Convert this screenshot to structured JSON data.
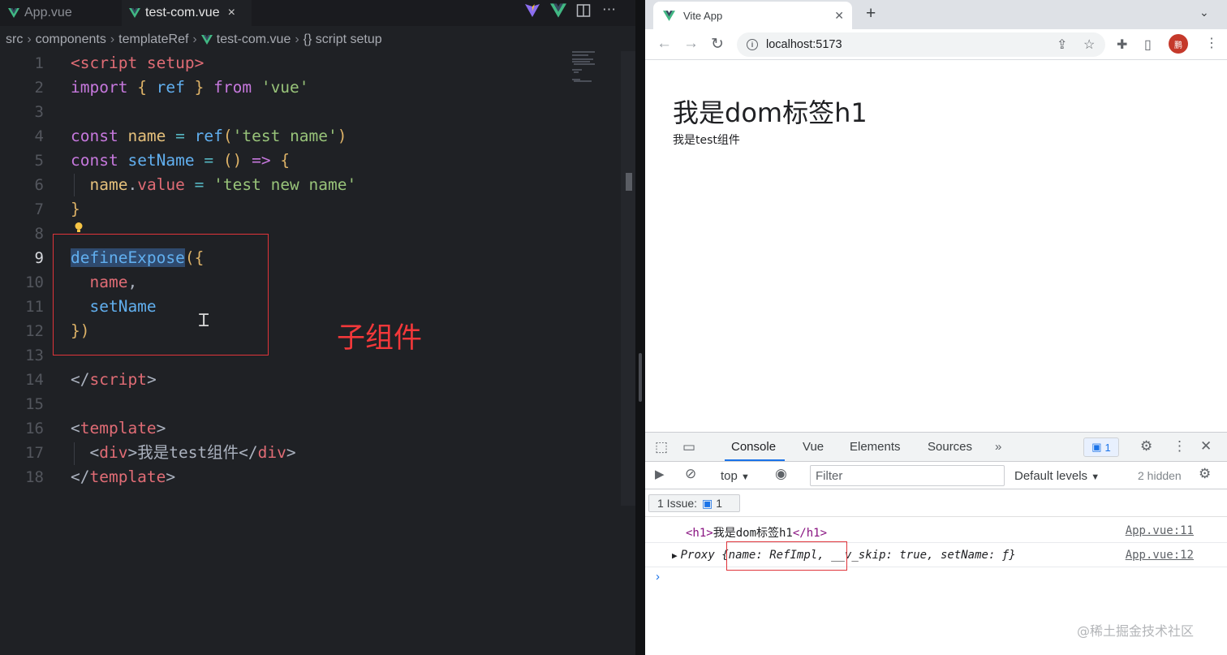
{
  "editor": {
    "tabs": [
      {
        "label": "App.vue",
        "active": false
      },
      {
        "label": "test-com.vue",
        "active": true
      }
    ],
    "tab_close": "×",
    "breadcrumb": [
      "src",
      "components",
      "templateRef",
      "test-com.vue",
      "{} script setup"
    ],
    "line_numbers": [
      "1",
      "2",
      "3",
      "4",
      "5",
      "6",
      "7",
      "8",
      "9",
      "10",
      "11",
      "12",
      "13",
      "14",
      "15",
      "16",
      "17",
      "18"
    ],
    "current_line": "9",
    "lines": [
      [
        [
          "t",
          "<script setup>"
        ]
      ],
      [
        [
          "k",
          "import "
        ],
        [
          "y",
          "{ "
        ],
        [
          "f",
          "ref "
        ],
        [
          "y",
          "} "
        ],
        [
          "k",
          "from "
        ],
        [
          "s",
          "'vue'"
        ]
      ],
      [],
      [
        [
          "k",
          "const "
        ],
        [
          "p",
          "name "
        ],
        [
          "c",
          "= "
        ],
        [
          "f",
          "ref"
        ],
        [
          "y",
          "("
        ],
        [
          "s",
          "'test name'"
        ],
        [
          "y",
          ")"
        ]
      ],
      [
        [
          "k",
          "const "
        ],
        [
          "f",
          "setName "
        ],
        [
          "c",
          "= "
        ],
        [
          "y",
          "() "
        ],
        [
          "k",
          "=> "
        ],
        [
          "y",
          "{"
        ]
      ],
      [
        [
          "g",
          "  "
        ],
        [
          "p",
          "name"
        ],
        [
          "g",
          "."
        ],
        [
          "t",
          "value "
        ],
        [
          "c",
          "= "
        ],
        [
          "s",
          "'test new name'"
        ]
      ],
      [
        [
          "y",
          "}"
        ]
      ],
      [],
      [
        [
          "fsel",
          "defineExpose"
        ],
        [
          "y",
          "({"
        ]
      ],
      [
        [
          "g",
          "  "
        ],
        [
          "t",
          "name"
        ],
        [
          "g",
          ","
        ]
      ],
      [
        [
          "g",
          "  "
        ],
        [
          "f",
          "setName"
        ]
      ],
      [
        [
          "y",
          "})"
        ]
      ],
      [],
      [
        [
          "g",
          "</"
        ],
        [
          "t",
          "script"
        ],
        [
          "g",
          ">"
        ]
      ],
      [],
      [
        [
          "g",
          "<"
        ],
        [
          "t",
          "template"
        ],
        [
          "g",
          ">"
        ]
      ],
      [
        [
          "g",
          "  <"
        ],
        [
          "t",
          "div"
        ],
        [
          "g",
          ">我是test组件</"
        ],
        [
          "t",
          "div"
        ],
        [
          "g",
          ">"
        ]
      ],
      [
        [
          "g",
          "</"
        ],
        [
          "t",
          "template"
        ],
        [
          "g",
          ">"
        ]
      ]
    ],
    "annotation": "子组件"
  },
  "browser": {
    "tab_title": "Vite App",
    "url": "localhost:5173",
    "page": {
      "h1": "我是dom标签h1",
      "div": "我是test组件"
    },
    "devtools": {
      "tabs": [
        "Console",
        "Vue",
        "Elements",
        "Sources"
      ],
      "active_tab": "Console",
      "message_count": "1",
      "context": "top",
      "filter_placeholder": "Filter",
      "levels": "Default levels",
      "hidden": "2 hidden",
      "issue_label": "1 Issue:",
      "issue_count": "1",
      "log": [
        {
          "text_open": "<h1>",
          "text": "我是dom标签h1",
          "text_close": "</h1>",
          "source": "App.vue:11"
        },
        {
          "prefix": "Proxy",
          "body": "{name: RefImpl,",
          "rest": "__v_skip: true, setName: ƒ}",
          "source": "App.vue:12"
        }
      ]
    }
  },
  "watermark": "@稀土掘金技术社区"
}
